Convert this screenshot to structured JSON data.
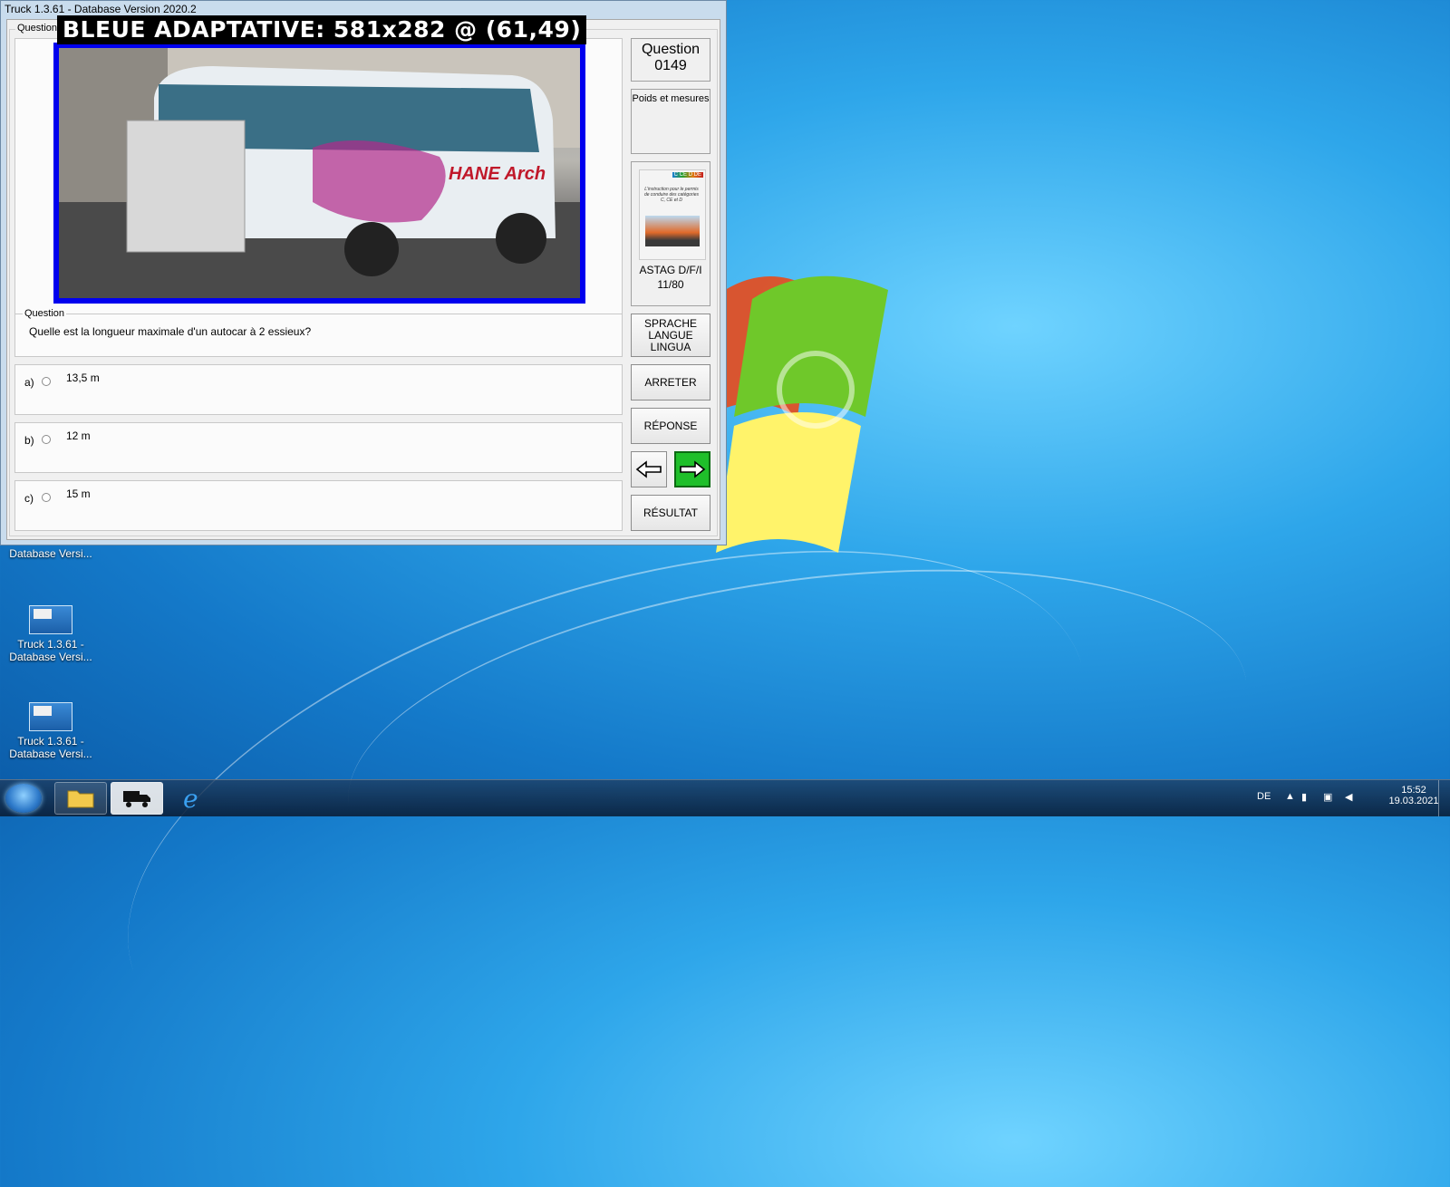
{
  "window": {
    "title": "Truck 1.3.61 - Database Version 2020.2",
    "group_label": "Questions"
  },
  "overlay": {
    "text": "BLEUE ADAPTATIVE: 581x282 @ (61,49)"
  },
  "side": {
    "question_heading": "Question",
    "question_number": "0149",
    "category": "Poids et mesures",
    "book_title": "ASTAG D/F/I",
    "book_page": "11/80",
    "book_cover_badges": "C CE D DE",
    "book_cover_text": "L'instruction pour le permis de conduire des catégories C, CE et D"
  },
  "question": {
    "label": "Question",
    "text": "Quelle est la longueur maximale d'un autocar à 2 essieux?"
  },
  "options": [
    {
      "letter": "a)",
      "text": "13,5 m"
    },
    {
      "letter": "b)",
      "text": "12 m"
    },
    {
      "letter": "c)",
      "text": "15 m"
    }
  ],
  "buttons": {
    "language_line1": "SPRACHE",
    "language_line2": "LANGUE",
    "language_line3": "LINGUA",
    "stop": "ARRETER",
    "answer": "RÉPONSE",
    "result": "RÉSULTAT"
  },
  "photo": {
    "bus_brand": "HANE Arch"
  },
  "desktop_icons": [
    {
      "line1": "Database Versi..."
    },
    {
      "line1": "Truck 1.3.61 -",
      "line2": "Database Versi..."
    },
    {
      "line1": "Truck 1.3.61 -",
      "line2": "Database Versi..."
    }
  ],
  "taskbar": {
    "language": "DE",
    "time": "15:52",
    "date": "19.03.2021"
  },
  "colors": {
    "photo_border": "#0000ee",
    "next_button": "#1fbf2a"
  }
}
